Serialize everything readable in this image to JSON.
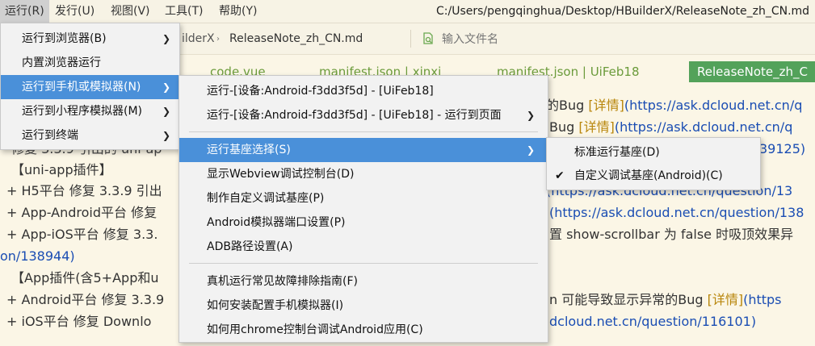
{
  "menubar": {
    "items": [
      "运行(R)",
      "发行(U)",
      "视图(V)",
      "工具(T)",
      "帮助(Y)"
    ],
    "path": "C:/Users/pengqinghua/Desktop/HBuilderX/ReleaseNote_zh_CN.md"
  },
  "toolbar": {
    "partial_crumb": "ilderX",
    "file_name": "ReleaseNote_zh_CN.md",
    "search_placeholder": "输入文件名"
  },
  "tabs": [
    "code.vue",
    "manifest.json | xinxi",
    "manifest.json | UiFeb18",
    "ReleaseNote_zh_C"
  ],
  "content_lines": [
    {
      "text": "的Bug ",
      "bracket": "[详情]",
      "link": "(https://ask.dcloud.net.cn/q"
    },
    {
      "text": "Bug ",
      "bracket": "[详情]",
      "link": "(https://ask.dcloud.net.cn/q"
    },
    {
      "text": "修复 3.3.9 引出的 uni-ap",
      "tail": "39125)"
    },
    {
      "text": "【uni-app插件】"
    },
    {
      "text": "+ H5平台 修复 3.3.9 引出",
      "link": "(https://ask.dcloud.net.cn/question/13"
    },
    {
      "text": "+ App-Android平台 修复",
      "link": "(https://ask.dcloud.net.cn/question/138"
    },
    {
      "text": "+ App-iOS平台 修复 3.3.",
      "tail": "置 show-scrollbar 为 false 时吸顶效果异"
    },
    {
      "link": "on/138944)"
    },
    {
      "text": "【App插件(含5+App和u"
    },
    {
      "text": "+ Android平台 修复 3.3.9",
      "tail": "n 可能导致显示异常的Bug ",
      "bracket": "[详情]",
      "link": "(https"
    },
    {
      "text": "+ iOS平台 修复 Downlo",
      "link": "dcloud.net.cn/question/116101)"
    }
  ],
  "run_menu": {
    "items": [
      "运行到浏览器(B)",
      "内置浏览器运行",
      "运行到手机或模拟器(N)",
      "运行到小程序模拟器(M)",
      "运行到终端"
    ]
  },
  "device_menu": {
    "items": [
      "运行-[设备:Android-f3dd3f5d] - [UiFeb18]",
      "运行-[设备:Android-f3dd3f5d] - [UiFeb18] - 运行到页面",
      "运行基座选择(S)",
      "显示Webview调试控制台(D)",
      "制作自定义调试基座(P)",
      "Android模拟器端口设置(P)",
      "ADB路径设置(A)",
      "真机运行常见故障排除指南(F)",
      "如何安装配置手机模拟器(I)",
      "如何用chrome控制台调试Android应用(C)"
    ]
  },
  "base_menu": {
    "items": [
      "标准运行基座(D)",
      "自定义调试基座(Android)(C)"
    ],
    "checked_index": 1
  }
}
